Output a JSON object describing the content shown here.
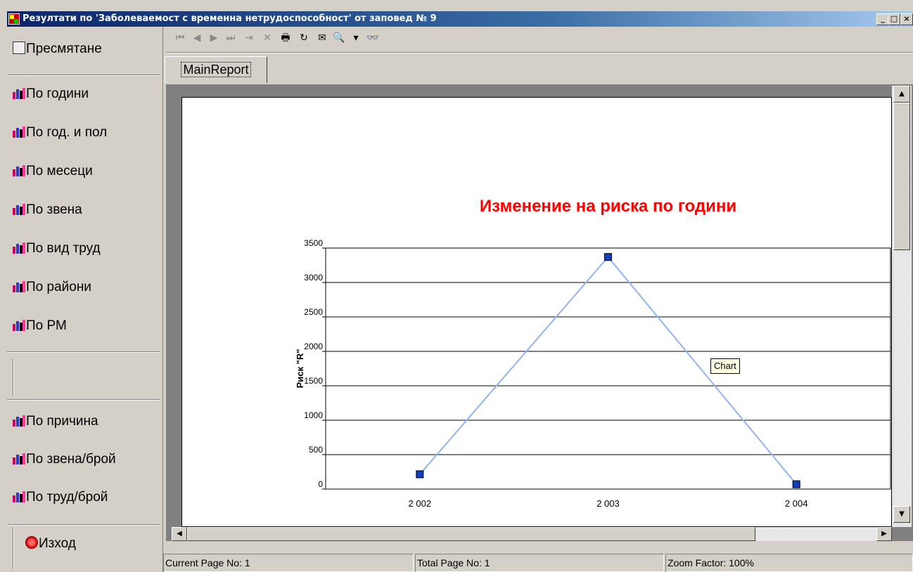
{
  "window": {
    "title": "Резултати по 'Заболеваемост с временна нетрудоспособност' от заповед № 9",
    "controls": {
      "minimize": "_",
      "maximize": "□",
      "close": "×"
    }
  },
  "sidebar": {
    "calc_label": "Пресмятане",
    "items": [
      {
        "label": "По години",
        "icon": "chart-icon"
      },
      {
        "label": "По год. и пол",
        "icon": "chart-icon"
      },
      {
        "label": "По месеци",
        "icon": "chart-icon"
      },
      {
        "label": "По звена",
        "icon": "chart-icon"
      },
      {
        "label": "По вид труд",
        "icon": "chart-icon"
      },
      {
        "label": "По райони",
        "icon": "chart-icon"
      },
      {
        "label": "По РМ",
        "icon": "chart-icon"
      }
    ],
    "items2": [
      {
        "label": "По причина",
        "icon": "chart-icon"
      },
      {
        "label": "По звена/брой",
        "icon": "chart-icon"
      },
      {
        "label": "По труд/брой",
        "icon": "chart-icon"
      }
    ],
    "exit_label": "Изход"
  },
  "toolbar": {
    "icons": [
      "first-page-icon",
      "prev-page-icon",
      "next-page-icon",
      "last-page-icon",
      "goto-page-icon",
      "stop-icon",
      "print-icon",
      "refresh-icon",
      "export-icon",
      "zoom-icon",
      "dropdown-icon",
      "search-icon"
    ],
    "glyphs": {
      "first": "⏮",
      "prev": "◀",
      "next": "▶",
      "last": "⏭",
      "goto": "⇥",
      "stop": "✕",
      "print": "🖶",
      "refresh": "↻",
      "export": "✉",
      "zoom": "🔍",
      "dropdown": "▾",
      "search": "👓"
    }
  },
  "tabs": {
    "main": "MainReport"
  },
  "chart_data": {
    "type": "line",
    "title": "Изменение на риска по години",
    "ylabel": "Риск \"R\"",
    "xlabel": "",
    "categories": [
      "2 002",
      "2 003",
      "2 004"
    ],
    "values": [
      215,
      3370,
      70
    ],
    "ylim": [
      0,
      3500
    ],
    "yticks": [
      0,
      500,
      1000,
      1500,
      2000,
      2500,
      3000,
      3500
    ],
    "grid": true,
    "line_color": "#8fb4f0",
    "marker_color": "#1040c0",
    "title_color": "#ff0000"
  },
  "tooltip": "Chart",
  "statusbar": {
    "current_page": "Current Page No: 1",
    "total_page": "Total Page No: 1",
    "zoom": "Zoom Factor: 100%"
  }
}
